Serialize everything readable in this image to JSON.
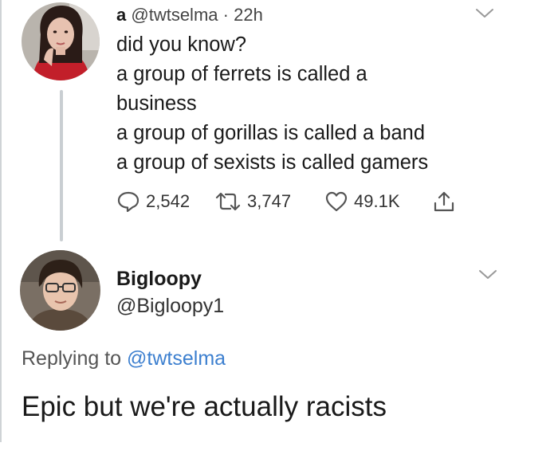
{
  "tweet": {
    "name": "a",
    "handle": "@twtselma",
    "separator": "·",
    "time": "22h",
    "lines": [
      "did you know?",
      "a group of ferrets is called a",
      "business",
      "a group of gorillas is called a band",
      "a group of sexists is called gamers"
    ],
    "replies": "2,542",
    "retweets": "3,747",
    "likes": "49.1K",
    "icons": {
      "menu": "chevron-down-icon",
      "reply": "speech-bubble-icon",
      "retweet": "retweet-arrows-icon",
      "like": "heart-outline-icon",
      "share": "share-upload-icon"
    }
  },
  "reply": {
    "name": "Bigloopy",
    "handle": "@Bigloopy1",
    "replying_prefix": "Replying to ",
    "replying_mention": "@twtselma",
    "text": "Epic but we're actually racists"
  },
  "colors": {
    "mention": "#3c7fcf",
    "icon": "#555555",
    "thread_line": "#c9ced2"
  }
}
